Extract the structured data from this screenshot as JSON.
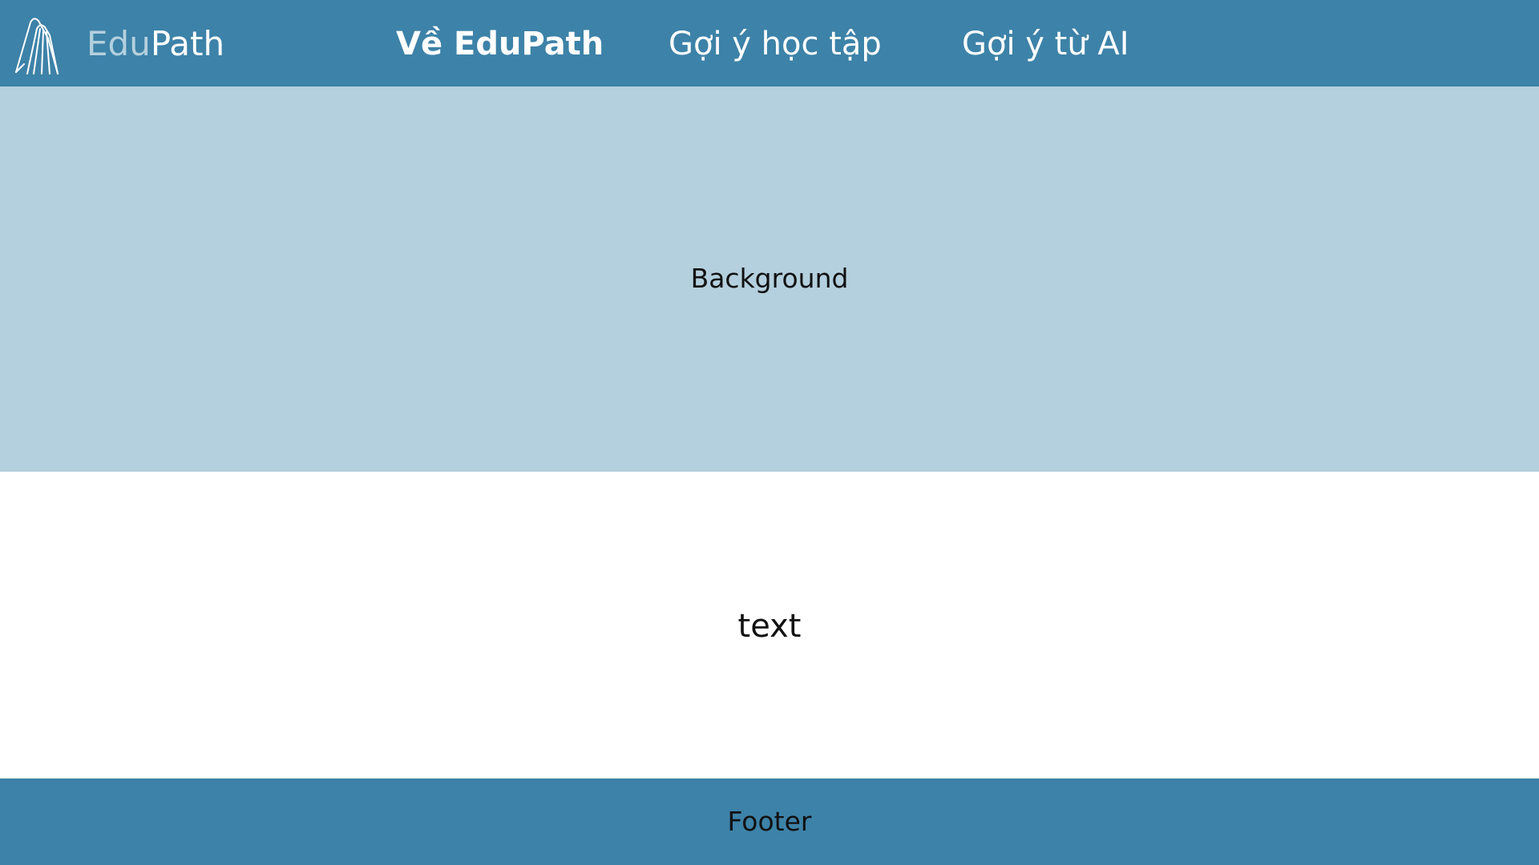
{
  "header": {
    "logo_icon": "umbrella-lines-logo",
    "brand": {
      "part1": "Edu",
      "part2": "Path"
    },
    "nav": [
      {
        "label": "Về EduPath",
        "active": true
      },
      {
        "label": "Gợi ý học tập",
        "active": false
      },
      {
        "label": "Gợi ý từ AI",
        "active": false
      }
    ]
  },
  "hero": {
    "label": "Background"
  },
  "content": {
    "label": "text"
  },
  "footer": {
    "label": "Footer"
  },
  "colors": {
    "header_bg": "#3d82a8",
    "hero_bg": "#b4d0de",
    "brand_accent": "#b4d0de",
    "nav_text": "#ffffff"
  }
}
